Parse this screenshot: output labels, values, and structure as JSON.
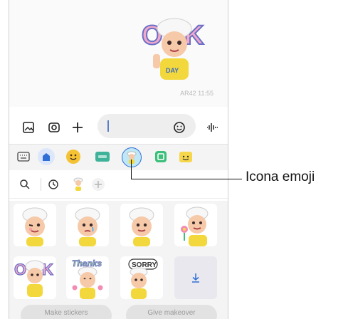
{
  "chat": {
    "timestamp": "AR42 11:55"
  },
  "composer": {
    "gallery_icon": "image-icon",
    "camera_icon": "camera-icon",
    "add_icon": "plus-icon",
    "emoji_icon": "smiley-icon",
    "voice_icon": "voice-wave-icon"
  },
  "tabs": [
    "keyboard",
    "bitmoji-home",
    "emoji",
    "gif",
    "ar-emoji",
    "sticker",
    "smiley-sticker",
    "add"
  ],
  "subrow": {
    "search_icon": "search-icon",
    "recent_icon": "clock-icon",
    "add_icon": "plus-icon"
  },
  "grid": {
    "stickers": [
      "Wink",
      "Tear",
      "Smile",
      "Flower",
      "OK",
      "Thanks",
      "SORRY"
    ],
    "download_icon": "download-icon",
    "buttons": [
      "Make stickers",
      "Give makeover"
    ]
  },
  "callout": {
    "label": "Icona emoji"
  },
  "colors": {
    "accent_blue": "#2f6fd6",
    "tab_selected": "#bfe7f5",
    "add_red": "#e8444e"
  }
}
